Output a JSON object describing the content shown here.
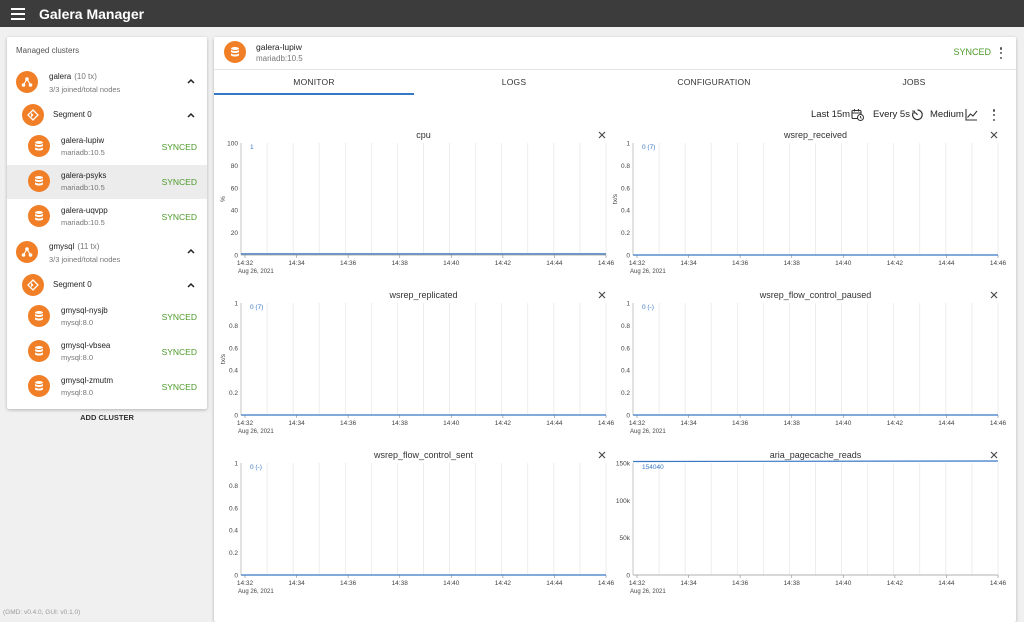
{
  "app": {
    "title": "Galera Manager"
  },
  "sidebar": {
    "title": "Managed clusters",
    "clusters": [
      {
        "name": "galera",
        "tx": "(10 tx)",
        "summary": "3/3 joined/total nodes",
        "segment": "Segment 0",
        "nodes": [
          {
            "name": "galera-lupiw",
            "version": "mariadb:10.5",
            "status": "SYNCED"
          },
          {
            "name": "galera-psyks",
            "version": "mariadb:10.5",
            "status": "SYNCED"
          },
          {
            "name": "galera-uqvpp",
            "version": "mariadb:10.5",
            "status": "SYNCED"
          }
        ]
      },
      {
        "name": "gmysql",
        "tx": "(11 tx)",
        "summary": "3/3 joined/total nodes",
        "segment": "Segment 0",
        "nodes": [
          {
            "name": "gmysql-nysjb",
            "version": "mysql:8.0",
            "status": "SYNCED"
          },
          {
            "name": "gmysql-vbsea",
            "version": "mysql:8.0",
            "status": "SYNCED"
          },
          {
            "name": "gmysql-zmutm",
            "version": "mysql:8.0",
            "status": "SYNCED"
          }
        ]
      }
    ],
    "add_cluster": "ADD CLUSTER",
    "version": "(GMD: v0.4.0, GUI: v0.1.0)"
  },
  "header": {
    "node_name": "galera-lupiw",
    "node_version": "mariadb:10.5",
    "status": "SYNCED"
  },
  "tabs": [
    "MONITOR",
    "LOGS",
    "CONFIGURATION",
    "JOBS"
  ],
  "toolbar": {
    "range": "Last 15m",
    "refresh": "Every 5s",
    "size": "Medium"
  },
  "colors": {
    "accent": "#f07f27",
    "synced": "#4c9a2a",
    "line": "#3877c4",
    "tab_indicator": "#3877c4"
  },
  "chart_data": [
    {
      "type": "line",
      "title": "cpu",
      "ylabel": "%",
      "ylim": [
        0,
        100
      ],
      "yticks": [
        "100",
        "80",
        "60",
        "40",
        "20",
        "0"
      ],
      "xticks": [
        "14:32",
        "14:34",
        "14:36",
        "14:38",
        "14:40",
        "14:42",
        "14:44",
        "14:46"
      ],
      "date": "Aug 26, 2021",
      "value_label": "1",
      "series": [
        {
          "values": [
            1,
            1
          ]
        }
      ]
    },
    {
      "type": "line",
      "title": "wsrep_received",
      "ylabel": "tx/s",
      "ylim": [
        0,
        1
      ],
      "yticks": [
        "1",
        "0.8",
        "0.6",
        "0.4",
        "0.2",
        "0"
      ],
      "xticks": [
        "14:32",
        "14:34",
        "14:36",
        "14:38",
        "14:40",
        "14:42",
        "14:44",
        "14:46"
      ],
      "date": "Aug 26, 2021",
      "value_label": "0 (7)",
      "series": [
        {
          "values": [
            0,
            0
          ]
        }
      ]
    },
    {
      "type": "line",
      "title": "wsrep_replicated",
      "ylabel": "tx/s",
      "ylim": [
        0,
        1
      ],
      "yticks": [
        "1",
        "0.8",
        "0.6",
        "0.4",
        "0.2",
        "0"
      ],
      "xticks": [
        "14:32",
        "14:34",
        "14:36",
        "14:38",
        "14:40",
        "14:42",
        "14:44",
        "14:46"
      ],
      "date": "Aug 26, 2021",
      "value_label": "0 (7)",
      "series": [
        {
          "values": [
            0,
            0
          ]
        }
      ]
    },
    {
      "type": "line",
      "title": "wsrep_flow_control_paused",
      "ylabel": "",
      "ylim": [
        0,
        1
      ],
      "yticks": [
        "1",
        "0.8",
        "0.6",
        "0.4",
        "0.2",
        "0"
      ],
      "xticks": [
        "14:32",
        "14:34",
        "14:36",
        "14:38",
        "14:40",
        "14:42",
        "14:44",
        "14:46"
      ],
      "date": "Aug 26, 2021",
      "value_label": "0 (-)",
      "series": [
        {
          "values": [
            0,
            0
          ]
        }
      ]
    },
    {
      "type": "line",
      "title": "wsrep_flow_control_sent",
      "ylabel": "",
      "ylim": [
        0,
        1
      ],
      "yticks": [
        "1",
        "0.8",
        "0.6",
        "0.4",
        "0.2",
        "0"
      ],
      "xticks": [
        "14:32",
        "14:34",
        "14:36",
        "14:38",
        "14:40",
        "14:42",
        "14:44",
        "14:46"
      ],
      "date": "Aug 26, 2021",
      "value_label": "0 (-)",
      "series": [
        {
          "values": [
            0,
            0
          ]
        }
      ]
    },
    {
      "type": "line",
      "title": "aria_pagecache_reads",
      "ylabel": "",
      "ylim": [
        0,
        150000
      ],
      "yticks": [
        "150k",
        "100k",
        "50k",
        "0"
      ],
      "xticks": [
        "14:32",
        "14:34",
        "14:36",
        "14:38",
        "14:40",
        "14:42",
        "14:44",
        "14:46"
      ],
      "date": "Aug 26, 2021",
      "value_label": "154040",
      "series": [
        {
          "values": [
            152000,
            154040
          ]
        }
      ]
    }
  ]
}
